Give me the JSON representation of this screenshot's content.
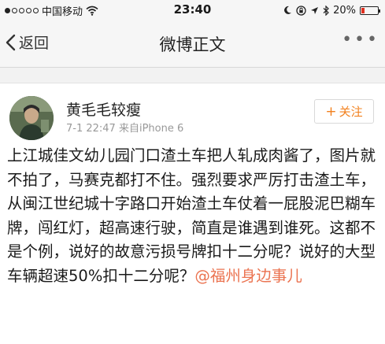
{
  "status_bar": {
    "carrier": "中国移动",
    "time": "23:40",
    "battery": "20%",
    "battery_level": 0.2
  },
  "nav": {
    "back_label": "返回",
    "title": "微博正文",
    "more_icon": "more-icon"
  },
  "post": {
    "author": "黄毛毛较瘦",
    "timestamp": "7-1 22:47",
    "source": "来自iPhone 6",
    "follow_label": "关注",
    "text": "上江城佳文幼儿园门口渣土车把人轧成肉酱了，图片就不拍了，马赛克都打不住。强烈要求严厉打击渣土车，从闽江世纪城十字路口开始渣土车仗着一屁股泥巴糊车牌，闯红灯，超高速行驶，简直是谁遇到谁死。这都不是个例，说好的故意污损号牌扣十二分呢？说好的大型车辆超速50%扣十二分呢？",
    "mention": "@福州身边事儿"
  },
  "colors": {
    "accent": "#f2801d",
    "mention": "#eb7350",
    "nav_bg": "#f6f6f6"
  }
}
